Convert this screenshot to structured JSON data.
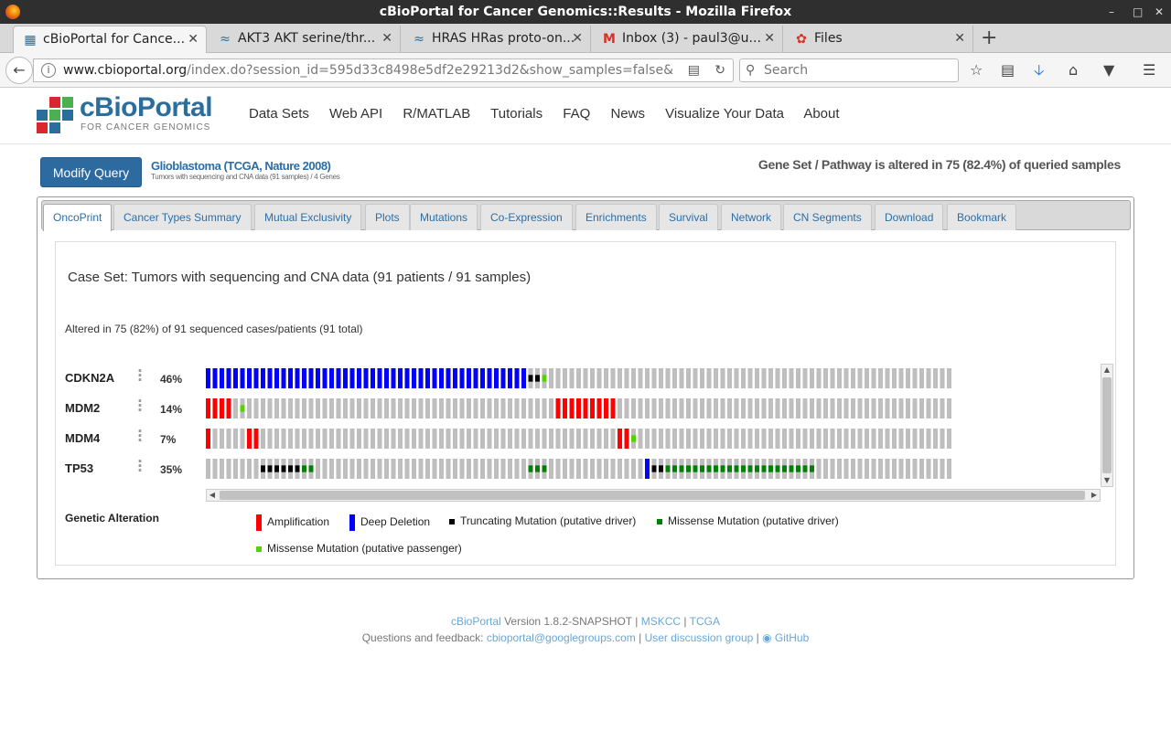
{
  "window": {
    "title": "cBioPortal for Cancer Genomics::Results - Mozilla Firefox"
  },
  "tabs": [
    {
      "label": "cBioPortal for Cance...",
      "icon": "cbioportal-favicon"
    },
    {
      "label": "AKT3 AKT serine/thr...",
      "icon": "ncbi-dna-icon"
    },
    {
      "label": "HRAS HRas proto-on...",
      "icon": "ncbi-dna-icon"
    },
    {
      "label": "Inbox (3) - paul3@u...",
      "icon": "gmail-icon"
    },
    {
      "label": "Files",
      "icon": "files-icon"
    }
  ],
  "urlbar": {
    "host": "www.cbioportal.org",
    "path": "/index.do?session_id=595d33c8498e5df2e29213d2&show_samples=false&"
  },
  "searchbar": {
    "placeholder": "Search"
  },
  "site": {
    "logo_text": "cBioPortal",
    "logo_sub": "FOR CANCER GENOMICS",
    "nav": [
      "Data Sets",
      "Web API",
      "R/MATLAB",
      "Tutorials",
      "FAQ",
      "News",
      "Visualize Your Data",
      "About"
    ]
  },
  "query": {
    "modify_label": "Modify Query",
    "study": "Glioblastoma (TCGA, Nature 2008)",
    "study_sub": "Tumors with sequencing and CNA data (91 samples) / 4 Genes",
    "summary": "Gene Set / Pathway is altered in 75 (82.4%) of queried samples"
  },
  "result_tabs": [
    "OncoPrint",
    "Cancer Types Summary",
    "Mutual Exclusivity",
    "Plots",
    "Mutations",
    "Co-Expression",
    "Enrichments",
    "Survival",
    "Network",
    "CN Segments",
    "Download",
    "Bookmark"
  ],
  "oncoprint": {
    "case_set": "Case Set: Tumors with sequencing and CNA data (91 patients / 91 samples)",
    "altered_line": "Altered in 75 (82%) of 91 sequenced cases/patients (91 total)",
    "genes": [
      {
        "name": "CDKN2A",
        "pct": "46%"
      },
      {
        "name": "MDM2",
        "pct": "14%"
      },
      {
        "name": "MDM4",
        "pct": "7%"
      },
      {
        "name": "TP53",
        "pct": "35%"
      }
    ],
    "track_codes": [
      "DDDDDDDDDDDDDDDDDDDDDDDDDDDDDDDDDDDDDDDDTTP",
      "AAAAP",
      "A",
      ""
    ],
    "legend_title": "Genetic Alteration",
    "legend": [
      {
        "label": "Amplification",
        "color": "#ff0000"
      },
      {
        "label": "Deep Deletion",
        "color": "#0000ff"
      },
      {
        "label": "Truncating Mutation (putative driver)",
        "color": "#000000"
      },
      {
        "label": "Missense Mutation (putative driver)",
        "color": "#008000"
      },
      {
        "label": "Missense Mutation (putative passenger)",
        "color": "#53d400"
      }
    ]
  },
  "footer": {
    "line1_link": "cBioPortal",
    "line1_version": "Version 1.8.2-SNAPSHOT",
    "line1_mskcc": "MSKCC",
    "line1_tcga": "TCGA",
    "line2_prefix": "Questions and feedback:",
    "line2_email": "cbioportal@googlegroups.com",
    "line2_group": "User discussion group",
    "line2_github": "GitHub"
  }
}
